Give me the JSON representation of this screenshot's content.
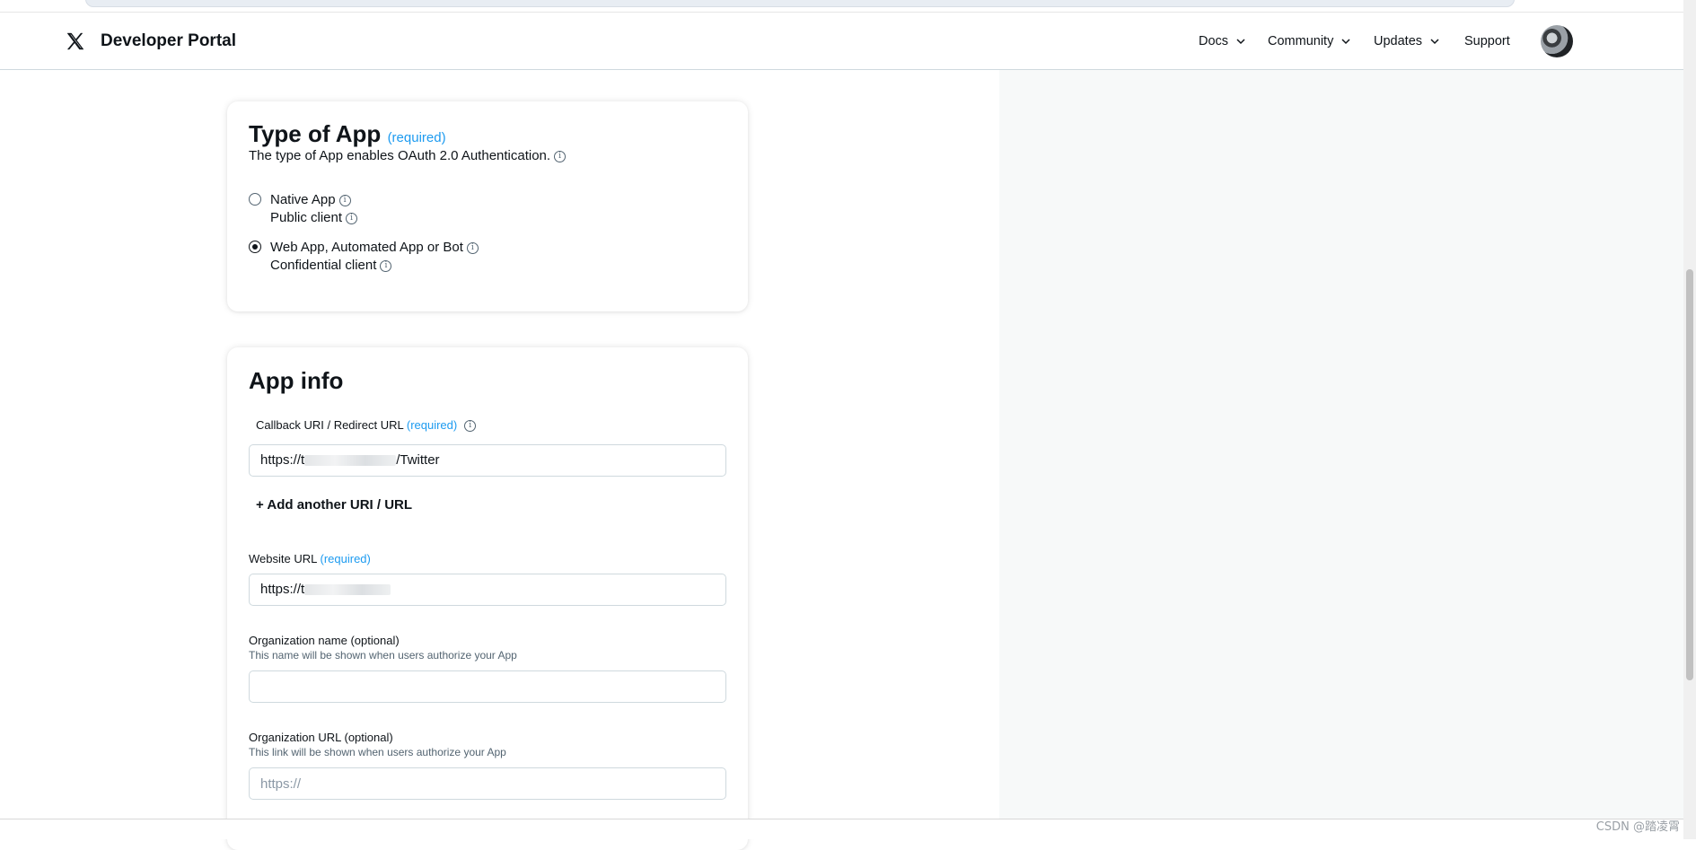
{
  "header": {
    "brand": "Developer Portal",
    "logo_icon": "x-logo-icon",
    "nav": [
      {
        "label": "Docs",
        "has_dropdown": true
      },
      {
        "label": "Community",
        "has_dropdown": true
      },
      {
        "label": "Updates",
        "has_dropdown": true
      },
      {
        "label": "Support",
        "has_dropdown": false
      }
    ]
  },
  "type_of_app": {
    "title": "Type of App",
    "required": "(required)",
    "description": "The type of App enables OAuth 2.0 Authentication.",
    "options": [
      {
        "label": "Native App",
        "sub": "Public client",
        "checked": false
      },
      {
        "label": "Web App, Automated App or Bot",
        "sub": "Confidential client",
        "checked": true
      }
    ]
  },
  "app_info": {
    "title": "App info",
    "callback": {
      "label": "Callback URI / Redirect URL",
      "required": "(required)",
      "value_prefix": "https://t",
      "value_suffix": "/Twitter"
    },
    "add_link": "+ Add another URI / URL",
    "website": {
      "label": "Website URL",
      "required": "(required)",
      "value_prefix": "https://t"
    },
    "org_name": {
      "label": "Organization name",
      "optional": "(optional)",
      "hint": "This name will be shown when users authorize your App",
      "value": ""
    },
    "org_url": {
      "label": "Organization URL",
      "optional": "(optional)",
      "hint": "This link will be shown when users authorize your App",
      "placeholder": "https://"
    }
  },
  "watermark": "CSDN @踏凌霄",
  "colors": {
    "accent": "#1d9bf0",
    "text": "#0f1419",
    "muted": "#536471",
    "panel": "#f7f9f9"
  }
}
